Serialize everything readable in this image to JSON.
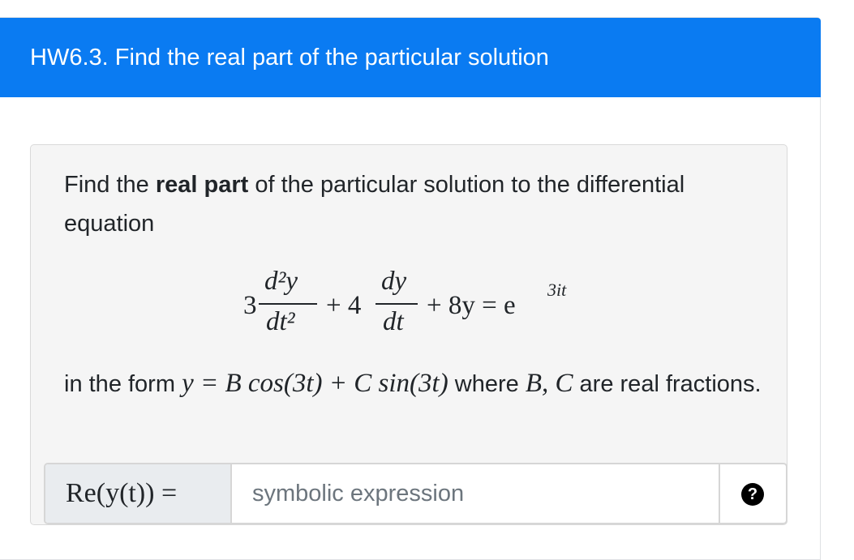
{
  "header": {
    "title": "HW6.3. Find the real part of the particular solution"
  },
  "question": {
    "prompt_start": "Find the ",
    "prompt_bold": "real part",
    "prompt_end": " of the particular solution to the differential equation",
    "equation": {
      "coef1": "3",
      "frac1_num": "d²y",
      "frac1_den": "dt²",
      "plus1": "+ 4",
      "frac2_num": "dy",
      "frac2_den": "dt",
      "rhs": "+ 8y = e",
      "exponent": "3it"
    },
    "form_text_start": "in the form ",
    "form_math": "y = B cos(3t) + C sin(3t)",
    "form_text_mid": " where ",
    "form_math_vars": "B, C",
    "form_text_end": " are real fractions."
  },
  "answer": {
    "label": "Re(y(t)) =",
    "placeholder": "symbolic expression",
    "value": "",
    "help_icon": "question-circle-icon",
    "help_label": "?"
  }
}
